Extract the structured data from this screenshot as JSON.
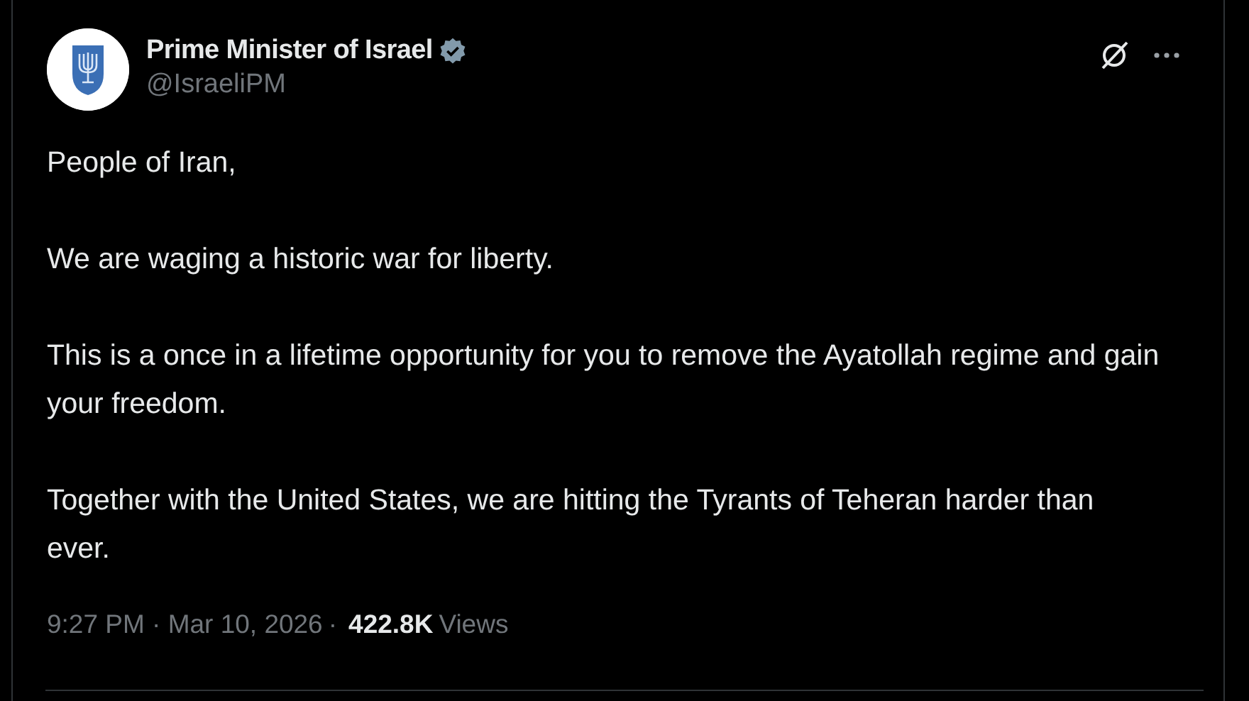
{
  "author": {
    "name": "Prime Minister of Israel",
    "verified": true,
    "handle": "@IsraeliPM"
  },
  "paragraphs": [
    "People of Iran,",
    "We are waging a historic war for liberty.",
    "This is a once in a lifetime opportunity for you to remove the Ayatollah regime and gain your freedom.",
    "Together with the United States, we are hitting the Tyrants of Teheran harder than ever."
  ],
  "timestamp": "9:27 PM · Mar 10, 2026",
  "separator": "·",
  "views": {
    "count": "422.8K",
    "label": "Views"
  }
}
